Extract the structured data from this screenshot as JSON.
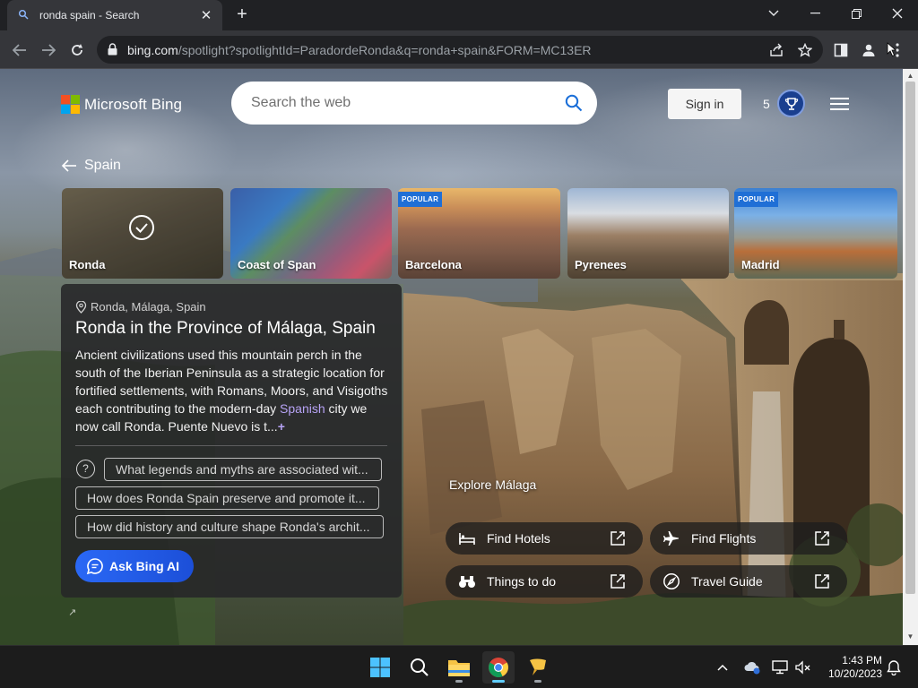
{
  "browser": {
    "tab_title": "ronda spain - Search",
    "url_host": "bing.com",
    "url_path": "/spotlight?spotlightId=ParadordeRonda&q=ronda+spain&FORM=MC13ER"
  },
  "header": {
    "brand": "Microsoft Bing",
    "search_placeholder": "Search the web",
    "signin_label": "Sign in",
    "rewards_count": "5"
  },
  "breadcrumb": {
    "label": "Spain"
  },
  "tiles": [
    {
      "label": "Ronda",
      "badge": "",
      "selected": true
    },
    {
      "label": "Coast of Span",
      "badge": ""
    },
    {
      "label": "Barcelona",
      "badge": "POPULAR"
    },
    {
      "label": "Pyrenees",
      "badge": ""
    },
    {
      "label": "Madrid",
      "badge": "POPULAR"
    }
  ],
  "card": {
    "location": "Ronda, Málaga, Spain",
    "title": "Ronda in the Province of Málaga, Spain",
    "desc_before": "Ancient civilizations used this mountain perch in the south of the Iberian Peninsula as a strategic location for fortified settlements, with Romans, Moors, and Visigoths each contributing to the modern-day ",
    "desc_link": "Spanish",
    "desc_after": " city we now call Ronda. Puente Nuevo is t...",
    "desc_more": "+",
    "question_icon": "?",
    "questions": [
      "What legends and myths are associated wit...",
      "How does Ronda Spain preserve and promote it...",
      "How did history and culture shape Ronda's archit..."
    ],
    "ask_label": "Ask Bing AI"
  },
  "explore": {
    "title": "Explore Málaga",
    "actions": [
      {
        "label": "Find Hotels",
        "icon": "bed-icon"
      },
      {
        "label": "Find Flights",
        "icon": "plane-icon"
      },
      {
        "label": "Things to do",
        "icon": "binoculars-icon"
      },
      {
        "label": "Travel Guide",
        "icon": "compass-icon"
      }
    ]
  },
  "taskbar": {
    "time": "1:43 PM",
    "date": "10/20/2023"
  },
  "colors": {
    "accent": "#1f6fd6",
    "ask_button": "#2a68f5",
    "link": "#b7a3f5"
  }
}
